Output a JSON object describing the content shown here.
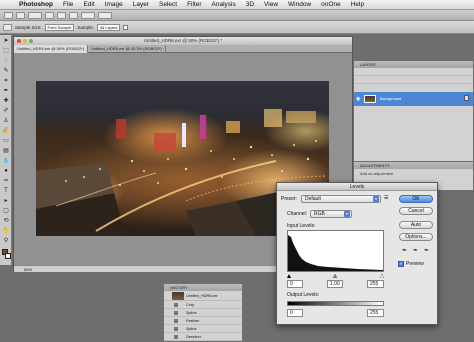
{
  "menubar": {
    "app_name": "Photoshop",
    "items": [
      "File",
      "Edit",
      "Image",
      "Layer",
      "Select",
      "Filter",
      "Analysis",
      "3D",
      "View",
      "Window",
      "onOne",
      "Help"
    ]
  },
  "options_bar": {
    "sample_size_label": "Sample Size:",
    "sample_size_value": "Point Sample",
    "sample_label": "Sample:",
    "sample_value": "All Layers"
  },
  "document": {
    "window_title": "Untitled_HDR6.exr @ 50% (RGB/32*) *",
    "tabs": [
      "Untitled_HDR4.exr @ 50% (RGB/32*)",
      "Untitled_HDR5.exr @ 33.3% (RGB/32*)"
    ],
    "status_zoom": "50%"
  },
  "layers_panel": {
    "title": "LAYERS",
    "layer_name": "Background"
  },
  "adjustments_panel": {
    "title": "ADJUSTMENTS",
    "label": "Add an adjustment"
  },
  "levels_dialog": {
    "title": "Levels",
    "preset_label": "Preset:",
    "preset_value": "Default",
    "channel_label": "Channel:",
    "channel_value": "RGB",
    "input_levels_label": "Input Levels:",
    "input_black": "0",
    "input_gamma": "1.00",
    "input_white": "255",
    "output_levels_label": "Output Levels:",
    "output_black": "0",
    "output_white": "255",
    "ok_label": "OK",
    "cancel_label": "Cancel",
    "auto_label": "Auto",
    "options_label": "Options...",
    "preview_label": "Preview",
    "preview_checked": true
  },
  "history_panel": {
    "title": "HISTORY",
    "snapshot": "Untitled_HDR6.exr",
    "steps": [
      "Crop",
      "Spline",
      "Feather",
      "Spline",
      "Deselect"
    ]
  },
  "colors": {
    "accent": "#4d7fd6",
    "selected_layer": "#4c86d6"
  }
}
